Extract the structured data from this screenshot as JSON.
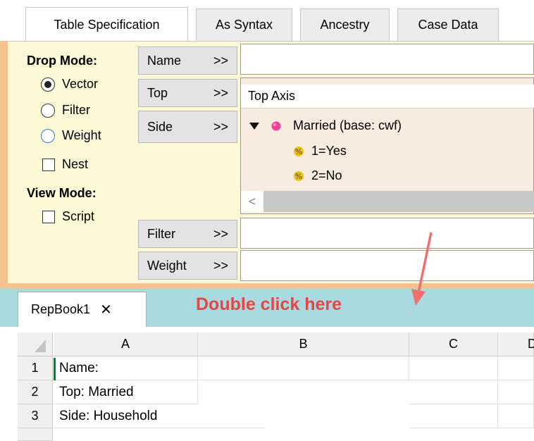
{
  "tabs": [
    {
      "label": "Table Specification",
      "active": true
    },
    {
      "label": "As Syntax",
      "active": false
    },
    {
      "label": "Ancestry",
      "active": false
    },
    {
      "label": "Case Data",
      "active": false
    }
  ],
  "drop_mode": {
    "title": "Drop Mode:",
    "options": [
      {
        "label": "Vector",
        "selected": true
      },
      {
        "label": "Filter",
        "selected": false
      },
      {
        "label": "Weight",
        "selected": false
      }
    ],
    "nest_label": "Nest"
  },
  "view_mode": {
    "title": "View Mode:",
    "script_label": "Script"
  },
  "fields": {
    "name_btn": "Name",
    "top_btn": "Top",
    "side_btn": "Side",
    "filter_btn": "Filter",
    "weight_btn": "Weight",
    "arrow": ">>"
  },
  "axis": {
    "header": "Top Axis",
    "root": "Married (base: cwf)",
    "children": [
      "1=Yes",
      "2=No"
    ],
    "scroll_left": "<"
  },
  "sheet": {
    "tab_label": "RepBook1",
    "close_glyph": "✕",
    "annotation": "Double click here",
    "columns": [
      "A",
      "B",
      "C",
      "D"
    ],
    "rows": [
      {
        "num": "1",
        "a": "Name:"
      },
      {
        "num": "2",
        "a": "Top: Married"
      },
      {
        "num": "3",
        "a": "Side: Household"
      }
    ]
  },
  "colors": {
    "panel_bg": "#fdf9d6",
    "accent_orange": "#f6c390",
    "sheetbar_teal": "#a8dadf",
    "annotation_red": "#e84545",
    "axis_bg": "#f8ebe0"
  },
  "icons": {
    "expand": "triangle-down-icon",
    "variable": "pink-dot-icon",
    "code": "percent-code-icon",
    "annotation_arrow": "red-arrow-icon"
  }
}
